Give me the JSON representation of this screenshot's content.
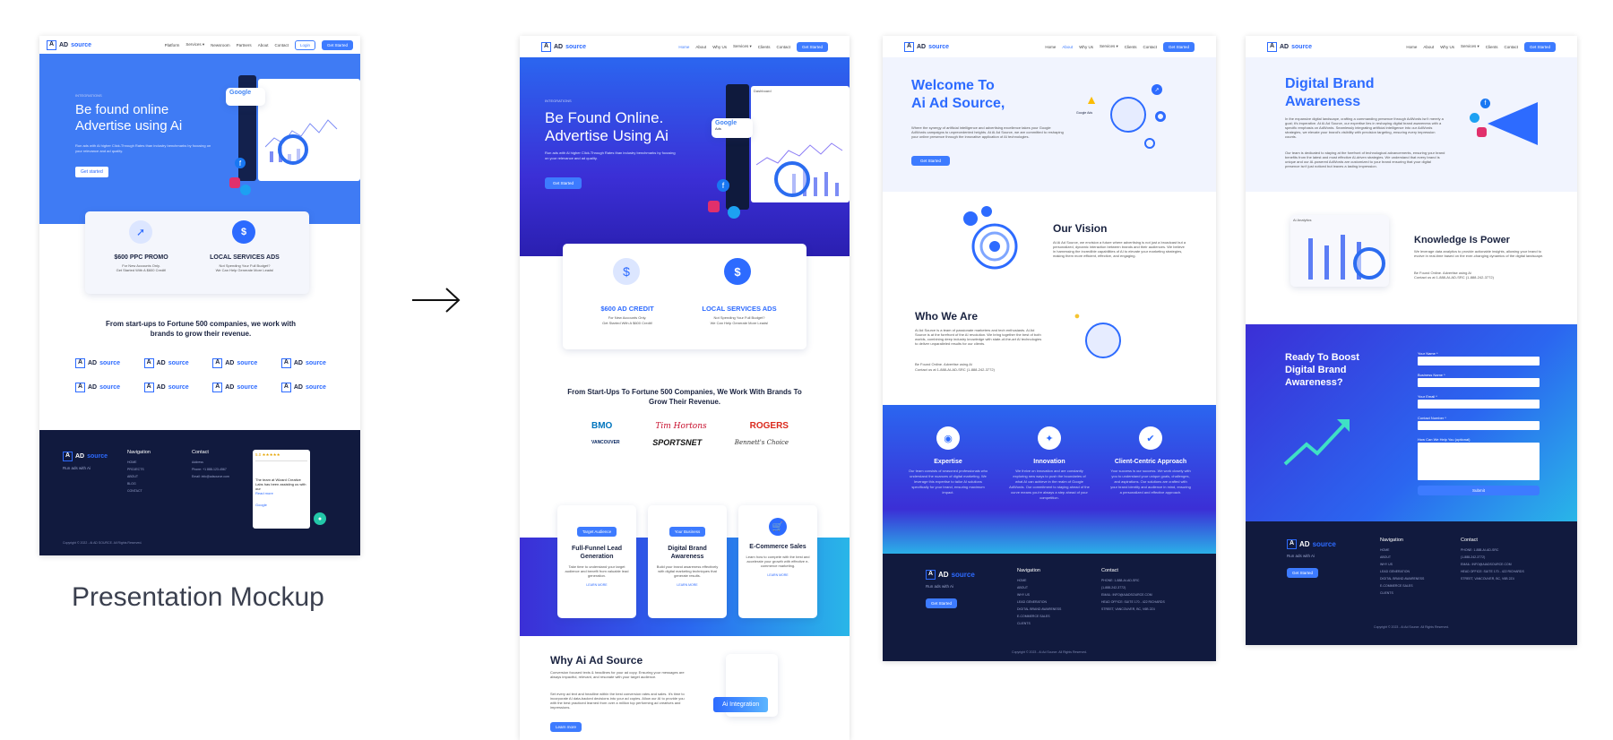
{
  "caption": "Presentation Mockup",
  "arrow_icon": "right-arrow-icon",
  "brand": {
    "mark": "A",
    "name_prefix": "AD",
    "name_suffix": "source",
    "tagline": "Run ads with Ai"
  },
  "mock1": {
    "nav": [
      "Platform",
      "Services ▾",
      "Newsroom",
      "Partners",
      "About",
      "Contact"
    ],
    "login": "Login",
    "cta": "Get Started",
    "eyebrow": "INTEGRATIONS",
    "title_line1": "Be found online",
    "title_line2": "Advertise using Ai",
    "sub": "Run ads with Ai higher Click-Through Rates than industry benchmarks by focusing on your relevance and ad quality.",
    "hero_btn": "Get started",
    "card1_title": "$600 PPC PROMO",
    "card1_sub1": "For New Accounts Only.",
    "card1_sub2": "Get Started With A $600 Credit!",
    "card2_title": "LOCAL SERVICES ADS",
    "card2_sub1": "Not Spending Your Full Budget?",
    "card2_sub2": "We Can Help Generate More Leads!",
    "partners_title": "From start-ups to Fortune 500 companies, we work with brands to grow their revenue.",
    "footer_nav_title": "Navigation",
    "footer_nav": [
      "HOME",
      "PROJECTS",
      "ABOUT",
      "BLOG",
      "CONTACT"
    ],
    "footer_contact_title": "Contact",
    "footer_contact": [
      "Address",
      "Phone: +1 888-123-4567",
      "Email: info@adsource.com"
    ],
    "review_score": "5.0 ★★★★★",
    "review_text": "The team at Wizard Creative Labs has been assisting us with our",
    "review_more": "Read more",
    "review_source": "Google",
    "copyright": "Copyright © 2022 - Ai AD SOURCE. All Rights Reserved."
  },
  "mock2": {
    "nav": [
      "Home",
      "About",
      "Why Us",
      "Services ▾",
      "Clients",
      "Contact"
    ],
    "cta": "Get Started",
    "eyebrow": "INTEGRATIONS",
    "title_line1": "Be Found Online.",
    "title_line2": "Advertise Using Ai",
    "sub": "Run ads with Ai higher Click-Through Rates than industry benchmarks by focusing on your relevance and ad quality.",
    "hero_btn": "Get Started",
    "dash_label": "Dashboard",
    "google_label": "Google",
    "ads_label": "Ads",
    "card1_title": "$600 AD CREDIT",
    "card1_sub1": "For New Accounts Only.",
    "card1_sub2": "Get Started With A $600 Credit!",
    "card2_title": "LOCAL SERVICES ADS",
    "card2_sub1": "Not Spending Your Full Budget?",
    "card2_sub2": "We Can Help Generate More Leads!",
    "partners_title": "From Start-Ups To Fortune 500 Companies, We Work With Brands To Grow Their Revenue.",
    "partners": [
      "BMO",
      "Tim Hortons",
      "ROGERS",
      "VANCOUVER",
      "SPORTSNET",
      "Bennett's Choice"
    ],
    "services": [
      {
        "pill": "Target Audience",
        "title": "Full-Funnel Lead Generation",
        "text": "Take time to understand your target audience and benefit from valuable lead generation.",
        "link": "LEARN MORE"
      },
      {
        "pill": "Your Business",
        "title": "Digital Brand Awareness",
        "text": "Build your brand awareness effectively with digital marketing techniques that generate results.",
        "link": "LEARN MORE"
      },
      {
        "pill": "",
        "title": "E-Commerce Sales",
        "text": "Learn how to compete with the best and accelerate your growth with effective e-commerce marketing.",
        "link": "LEARN MORE"
      }
    ],
    "why_title": "Why Ai Ad Source",
    "why_p1": "Conversion focused texts & headlines for your ad copy. Ensuring your messages are always impactful, relevant, and resonate with your target audience.",
    "why_p2": "Set every ad text and headline within the best conversion rates and sales. It's time to incorporate AI data-backed decisions into your ad copies. Allow our AI to provide you with the best practiced learned from over a million top performing ad creatives and impressions.",
    "why_btn": "Learn more",
    "integration": "Ai Integration"
  },
  "mock3": {
    "nav": [
      "Home",
      "About",
      "Why Us",
      "Services ▾",
      "Clients",
      "Contact"
    ],
    "cta": "Get Started",
    "title_line1": "Welcome To",
    "title_line2": "Ai Ad Source,",
    "intro": "Where the synergy of artificial intelligence and advertising excellence takes your Google AdWords campaigns to unprecedented heights. At Ai Ad Source, we are committed to reshaping your online presence through the innovative application of AI technologies.",
    "hero_btn": "Get Started",
    "google_ads": "Google Ads",
    "vision_title": "Our Vision",
    "vision_text": "At Ai Ad Source, we envision a future where advertising is not just a broadcast but a personalized, dynamic interaction between brands and their audiences. We believe in harnessing the incredible capabilities of AI to elevate your marketing strategies, making them more efficient, effective, and engaging.",
    "who_title": "Who We Are",
    "who_text": "Ai Ad Source is a team of passionate marketers and tech enthusiasts. Ai Ad Source is at the forefront of the AI revolution. We bring together the best of both worlds, combining deep industry knowledge with state-of-the-art AI technologies to deliver unparalleled results for our clients.",
    "who_contact1": "Be Found Online. Advertise using Ai",
    "who_contact2": "Contact us at 1-888-AI-AD-SRC (1-888-242-3772)",
    "features": [
      {
        "title": "Expertise",
        "text": "Our team consists of seasoned professionals who understand the nuances of digital marketing. We leverage this expertise to tailor AI solutions specifically for your brand, ensuring maximum impact."
      },
      {
        "title": "Innovation",
        "text": "We thrive on innovation and are constantly exploring new ways to push the boundaries of what AI can achieve in the realm of Google AdWords. Our commitment to staying ahead of the curve means you're always a step ahead of your competition."
      },
      {
        "title": "Client-Centric Approach",
        "text": "Your success is our success. We work closely with you to understand your unique goals, challenges, and aspirations. Our solutions are crafted with your brand identity and audience in mind, ensuring a personalized and effective approach."
      }
    ],
    "footer_btn": "Get Started",
    "footer_nav_title": "Navigation",
    "footer_nav": [
      "HOME",
      "ABOUT",
      "WHY US",
      "LEAD GENERATION",
      "DIGITAL BRAND AWARENESS",
      "E-COMMERCE SALES",
      "CLIENTS"
    ],
    "footer_contact_title": "Contact",
    "footer_contact": [
      "PHONE: 1-888-AI-AD-SRC",
      "(1-888-242-3772)",
      "EMAIL: INFO@AIADSOURCE.COM",
      "HEAD OFFICE: SUITE 170 - 422 RICHARDS",
      "STREET, VANCOUVER, BC, V6B 2Z4"
    ],
    "copyright": "Copyright © 2023 - Ai Ad Source. All Rights Reserved."
  },
  "mock4": {
    "nav": [
      "Home",
      "About",
      "Why Us",
      "Services ▾",
      "Clients",
      "Contact"
    ],
    "cta": "Get Started",
    "title_line1": "Digital Brand",
    "title_line2": "Awareness",
    "p1": "In the expansive digital landscape, crafting a commanding presence through AdWords isn't merely a goal; it's imperative. At Ai Ad Source, our expertise lies in reshaping digital brand awareness with a specific emphasis on AdWords. Seamlessly integrating artificial intelligence into our AdWords strategies, we elevate your brand's visibility with precision targeting, ensuring every impression counts.",
    "p2": "Our team is dedicated to staying at the forefront of technological advancements, ensuring your brand benefits from the latest and most effective AI-driven strategies. We understand that every brand is unique and our AI-powered AdWords are customized to your brand ensuring that your digital presence isn't just noticed but leaves a lasting impression.",
    "analytics_label": "Ai Analytics",
    "knowledge_title": "Knowledge Is Power",
    "knowledge_text": "We leverage data analytics to provide actionable insights, allowing your brand to evolve in real-time based on the ever-changing dynamics of the digital landscape.",
    "knowledge_contact1": "Be Found Online. Advertise using Ai",
    "knowledge_contact2": "Contact us at 1-888-AI-AD-SRC (1-888-242-3772)",
    "form_title": "Ready To Boost Digital Brand Awareness?",
    "fields": [
      "Your Name *",
      "Business Name *",
      "Your Email *",
      "Contact Number *",
      "How Can We Help You (optional)"
    ],
    "submit": "Submit",
    "footer_btn": "Get Started",
    "footer_nav_title": "Navigation",
    "footer_nav": [
      "HOME",
      "ABOUT",
      "WHY US",
      "LEAD GENERATION",
      "DIGITAL BRAND AWARENESS",
      "E-COMMERCE SALES",
      "CLIENTS"
    ],
    "footer_contact_title": "Contact",
    "footer_contact": [
      "PHONE: 1-888-AI-AD-SRC",
      "(1-888-242-3772)",
      "EMAIL: INFO@AIADSOURCE.COM",
      "HEAD OFFICE: SUITE 170 - 422 RICHARDS",
      "STREET, VANCOUVER, BC, V6B 2Z4"
    ],
    "copyright": "Copyright © 2023 - Ai Ad Source. All Rights Reserved."
  },
  "colors": {
    "primary": "#3d7bff",
    "dark": "#111a3e",
    "accent_purple": "#3b2fd6"
  }
}
